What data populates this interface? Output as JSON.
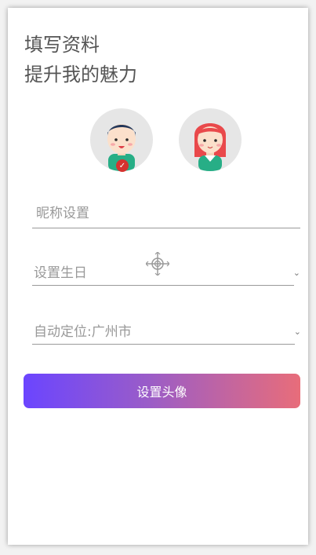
{
  "header": {
    "line1": "填写资料",
    "line2": "提升我的魅力"
  },
  "avatars": {
    "male": {
      "icon": "male-avatar-icon",
      "selected": true
    },
    "female": {
      "icon": "female-avatar-icon",
      "selected": false
    }
  },
  "form": {
    "nickname_placeholder": "昵称设置",
    "birthday_label": "设置生日",
    "location_label": "自动定位:广州市"
  },
  "actions": {
    "set_avatar_label": "设置头像"
  },
  "colors": {
    "button_gradient_start": "#6b45ff",
    "button_gradient_end": "#e86d7a",
    "selected_badge": "#d6322f"
  }
}
